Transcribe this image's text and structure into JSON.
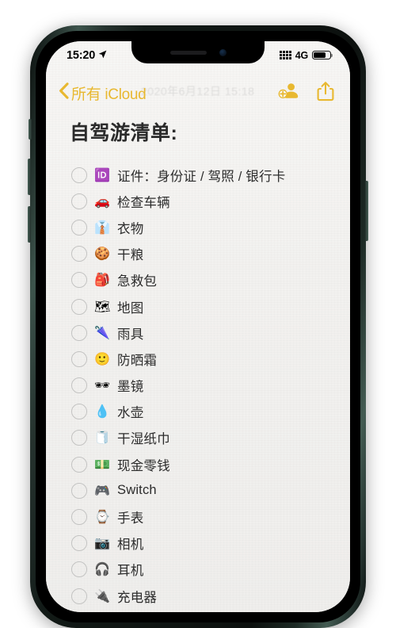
{
  "device": {
    "frame_color": "#24302c",
    "buttons": [
      "mute-switch",
      "volume-up",
      "volume-down",
      "power"
    ]
  },
  "status_bar": {
    "time": "15:20",
    "location_icon": "location-arrow-icon",
    "signal_icon": "signal-dots-icon",
    "network": "4G",
    "battery_icon": "battery-icon",
    "battery_level_percent": 78
  },
  "nav_bar": {
    "back_icon": "chevron-left-icon",
    "back_label": "所有 iCloud",
    "accent_color": "#e8b830",
    "actions": [
      {
        "icon": "add-person-icon",
        "name": "add-collaborator-button"
      },
      {
        "icon": "share-icon",
        "name": "share-button"
      }
    ],
    "watermark": "2020年6月12日 15:18"
  },
  "note": {
    "title": "自驾游清单:",
    "items": [
      {
        "emoji": "🆔",
        "icon_name": "id-badge-emoji",
        "label": "证件：身份证 / 驾照 / 银行卡",
        "checked": false
      },
      {
        "emoji": "🚗",
        "icon_name": "car-emoji",
        "label": "检查车辆",
        "checked": false
      },
      {
        "emoji": "👔",
        "icon_name": "necktie-emoji",
        "label": "衣物",
        "checked": false
      },
      {
        "emoji": "🍪",
        "icon_name": "cookie-emoji",
        "label": "干粮",
        "checked": false
      },
      {
        "emoji": "🎒",
        "icon_name": "backpack-emoji",
        "label": "急救包",
        "checked": false
      },
      {
        "emoji": "🗺",
        "icon_name": "map-emoji",
        "label": "地图",
        "checked": false
      },
      {
        "emoji": "🌂",
        "icon_name": "umbrella-emoji",
        "label": "雨具",
        "checked": false
      },
      {
        "emoji": "🙂",
        "icon_name": "smiling-face-emoji",
        "label": "防晒霜",
        "checked": false
      },
      {
        "emoji": "🕶",
        "icon_name": "sunglasses-emoji",
        "label": "墨镜",
        "checked": false
      },
      {
        "emoji": "💧",
        "icon_name": "water-drop-emoji",
        "label": "水壶",
        "checked": false
      },
      {
        "emoji": "🧻",
        "icon_name": "toilet-paper-emoji",
        "label": "干湿纸巾",
        "checked": false
      },
      {
        "emoji": "💵",
        "icon_name": "banknote-emoji",
        "label": "现金零钱",
        "checked": false
      },
      {
        "emoji": "🎮",
        "icon_name": "game-controller-emoji",
        "label": "Switch",
        "checked": false
      },
      {
        "emoji": "⌚",
        "icon_name": "watch-emoji",
        "label": "手表",
        "checked": false
      },
      {
        "emoji": "📷",
        "icon_name": "camera-emoji",
        "label": "相机",
        "checked": false
      },
      {
        "emoji": "🎧",
        "icon_name": "headphones-emoji",
        "label": "耳机",
        "checked": false
      },
      {
        "emoji": "🔌",
        "icon_name": "plug-emoji",
        "label": "充电器",
        "checked": false
      }
    ]
  }
}
